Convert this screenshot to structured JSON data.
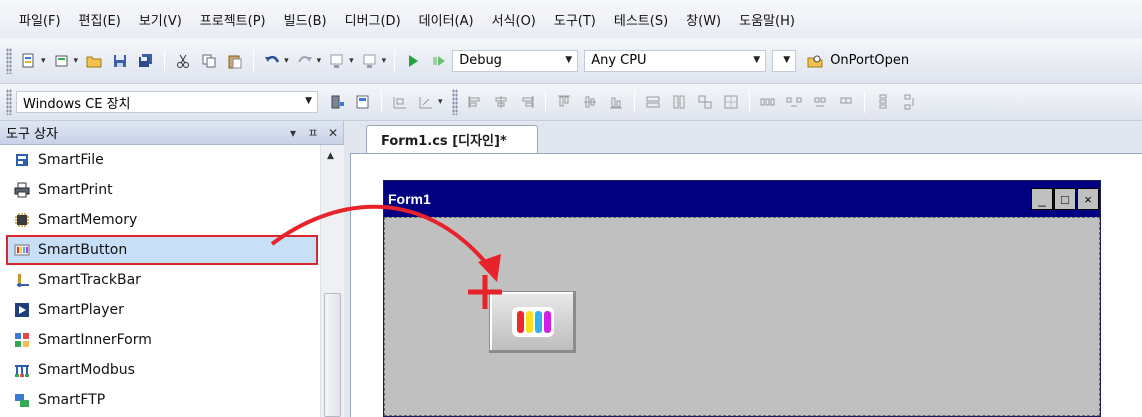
{
  "menu": [
    {
      "id": "file",
      "label": "파일(F)"
    },
    {
      "id": "edit",
      "label": "편집(E)"
    },
    {
      "id": "view",
      "label": "보기(V)"
    },
    {
      "id": "project",
      "label": "프로젝트(P)"
    },
    {
      "id": "build",
      "label": "빌드(B)"
    },
    {
      "id": "debug",
      "label": "디버그(D)"
    },
    {
      "id": "data",
      "label": "데이터(A)"
    },
    {
      "id": "format",
      "label": "서식(O)"
    },
    {
      "id": "tools",
      "label": "도구(T)"
    },
    {
      "id": "test",
      "label": "테스트(S)"
    },
    {
      "id": "window",
      "label": "창(W)"
    },
    {
      "id": "help",
      "label": "도움말(H)"
    }
  ],
  "toolbar": {
    "config": "Debug",
    "platform": "Any CPU",
    "find": "OnPortOpen",
    "device": "Windows CE 장치"
  },
  "toolbox": {
    "title": "도구 상자",
    "pin": "ㅍ",
    "close": "✕",
    "items": [
      {
        "label": "SmartFile",
        "icon": "smartfile-icon"
      },
      {
        "label": "SmartPrint",
        "icon": "printer-icon"
      },
      {
        "label": "SmartMemory",
        "icon": "chip-icon"
      },
      {
        "label": "SmartButton",
        "icon": "color-bars-icon",
        "selected": true
      },
      {
        "label": "SmartTrackBar",
        "icon": "trackbar-icon"
      },
      {
        "label": "SmartPlayer",
        "icon": "play-icon"
      },
      {
        "label": "SmartInnerForm",
        "icon": "inner-form-icon"
      },
      {
        "label": "SmartModbus",
        "icon": "modbus-icon"
      },
      {
        "label": "SmartFTP",
        "icon": "ftp-icon"
      }
    ]
  },
  "document": {
    "tab_label": "Form1.cs [디자인]*"
  },
  "form": {
    "title": "Form1",
    "minimize": "_",
    "maximize": "□",
    "close": "×"
  },
  "colors": {
    "form_title_bg": "#000080",
    "selection_outline": "#d9262c",
    "drag_arrow": "#e8222a",
    "selected_item_bg": "#c7e0f8"
  }
}
